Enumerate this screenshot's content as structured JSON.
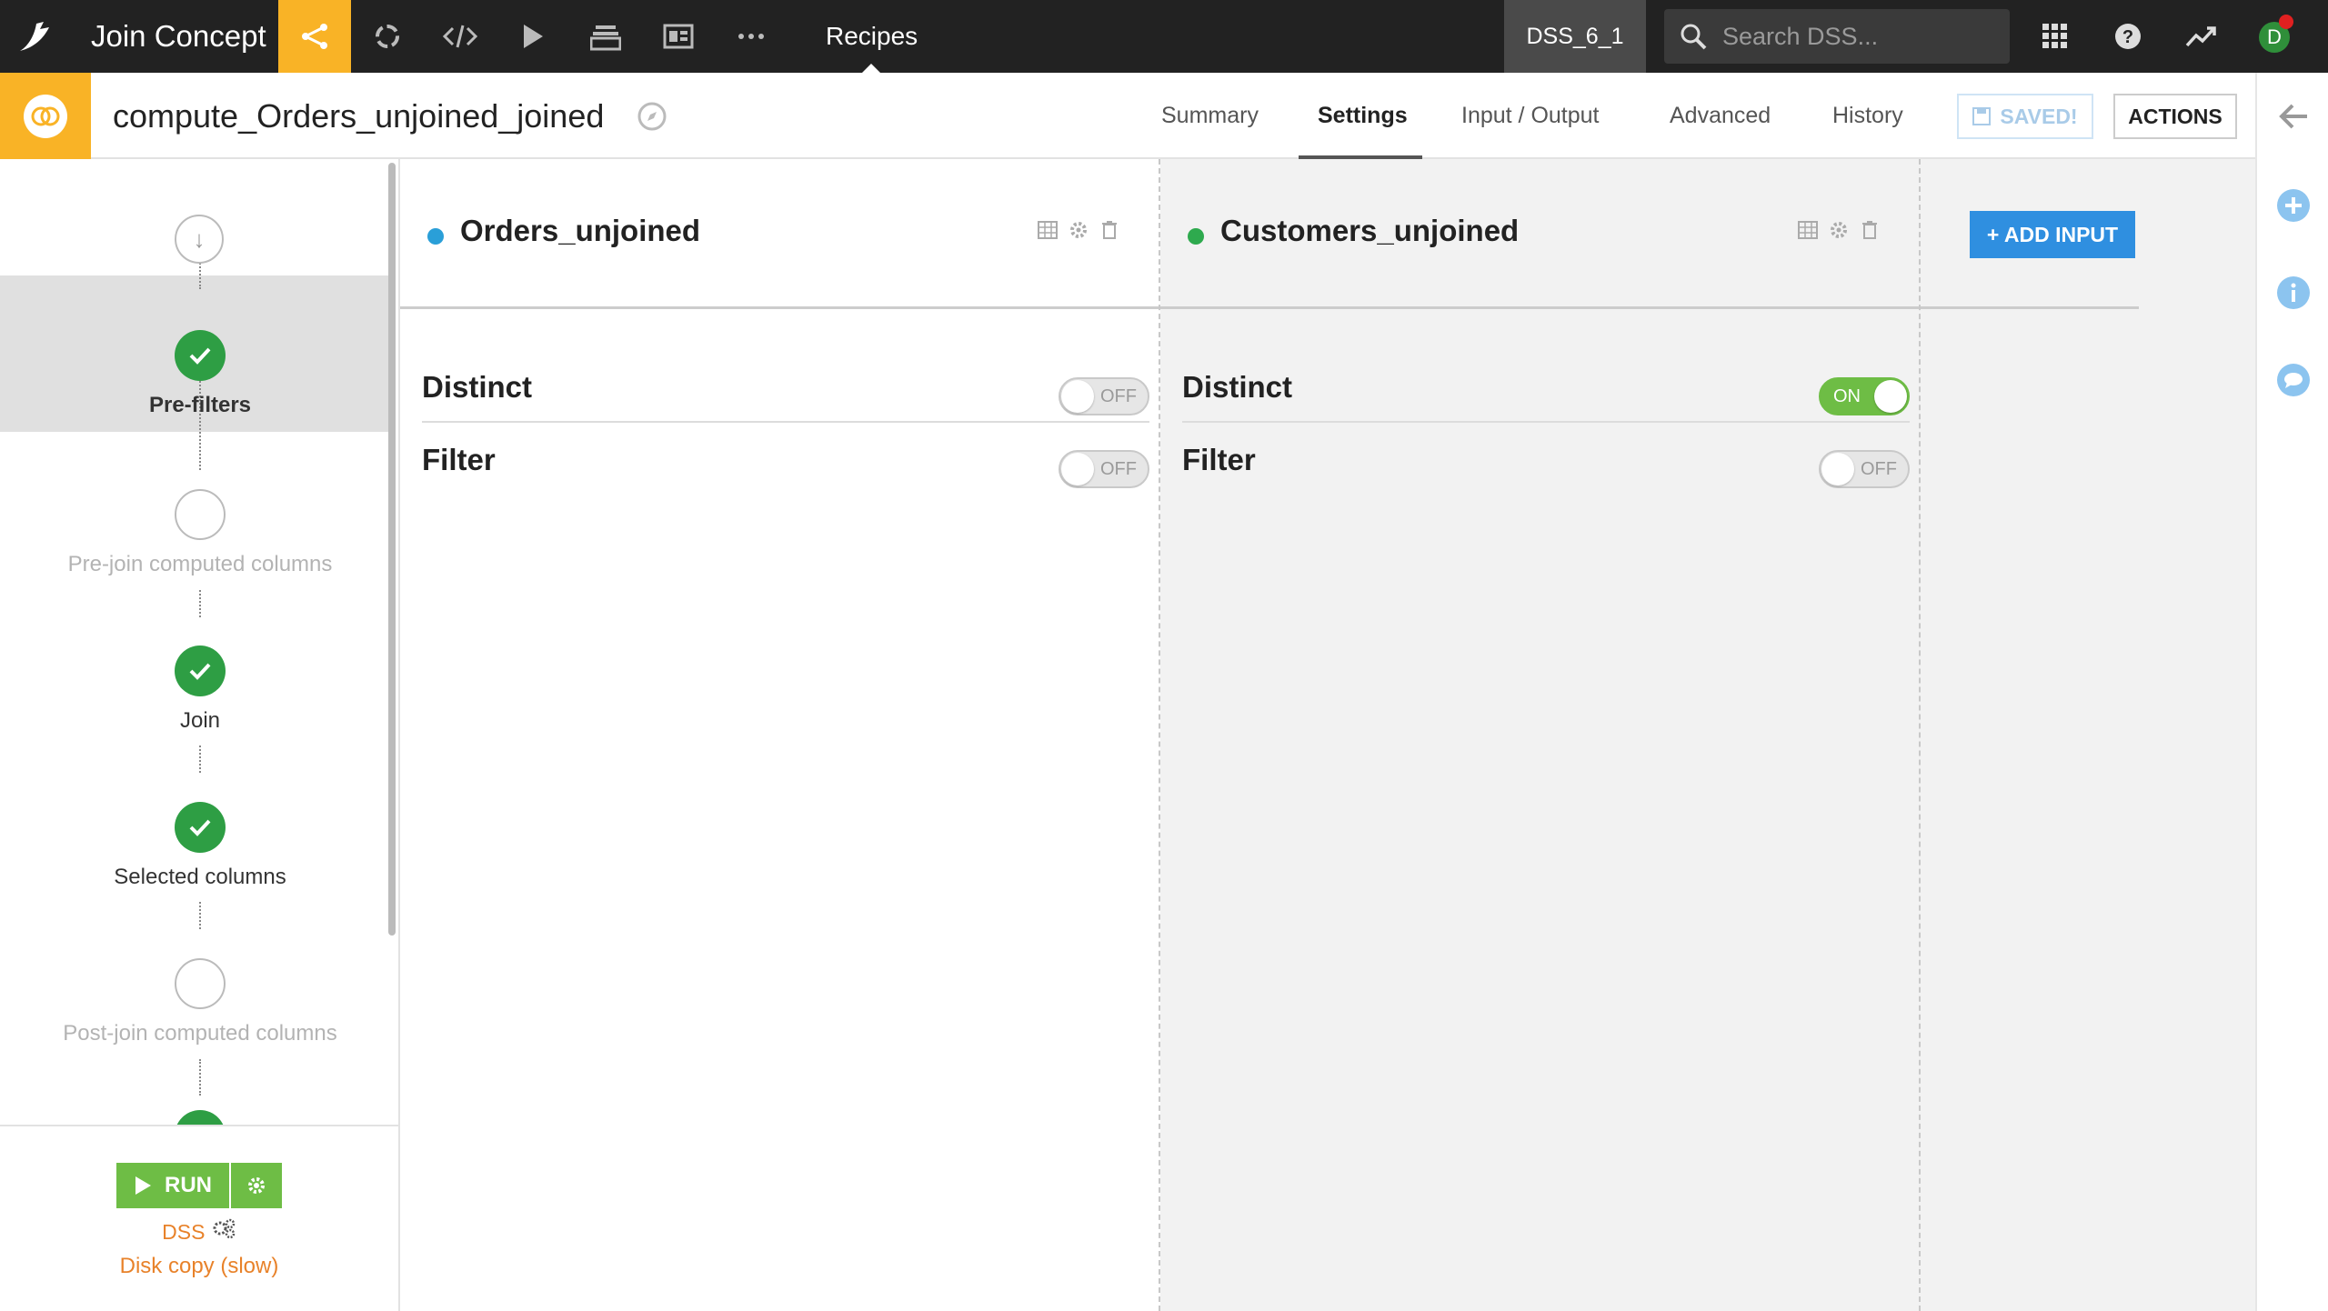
{
  "topbar": {
    "project_name": "Join Concept",
    "current_section": "Recipes",
    "instance_name": "DSS_6_1",
    "search_placeholder": "Search DSS...",
    "avatar_letter": "D",
    "icons": [
      "dataiku-logo-icon",
      "flow-icon",
      "lab-icon",
      "code-icon",
      "run-icon",
      "stack-icon",
      "dashboard-icon",
      "more-icon",
      "search-icon",
      "apps-grid-icon",
      "help-icon",
      "trend-icon"
    ],
    "colors": {
      "background": "#222222",
      "active_flow": "#f9b326",
      "notification": "#e02020"
    }
  },
  "recipe_header": {
    "title": "compute_Orders_unjoined_joined",
    "tabs": [
      {
        "label": "Summary",
        "active": false
      },
      {
        "label": "Settings",
        "active": true
      },
      {
        "label": "Input / Output",
        "active": false
      },
      {
        "label": "Advanced",
        "active": false
      },
      {
        "label": "History",
        "active": false
      }
    ],
    "saved_label": "SAVED!",
    "actions_label": "ACTIONS"
  },
  "steps": [
    {
      "label": "",
      "state": "start"
    },
    {
      "label": "Pre-filters",
      "state": "done",
      "active": true
    },
    {
      "label": "Pre-join computed columns",
      "state": "empty"
    },
    {
      "label": "Join",
      "state": "done"
    },
    {
      "label": "Selected columns",
      "state": "done"
    },
    {
      "label": "Post-join computed columns",
      "state": "empty"
    }
  ],
  "run_panel": {
    "run_label": "RUN",
    "engine_label": "DSS",
    "engine_detail": "Disk copy (slow)"
  },
  "inputs": [
    {
      "name": "Orders_unjoined",
      "dot_color": "#2a9fd8",
      "settings": [
        {
          "label": "Distinct",
          "state": "OFF"
        },
        {
          "label": "Filter",
          "state": "OFF"
        }
      ]
    },
    {
      "name": "Customers_unjoined",
      "dot_color": "#2eaa4e",
      "settings": [
        {
          "label": "Distinct",
          "state": "ON"
        },
        {
          "label": "Filter",
          "state": "OFF"
        }
      ]
    }
  ],
  "add_input_label": "+ ADD INPUT",
  "right_rail_icons": [
    "back-arrow-icon",
    "plus-circle-icon",
    "info-circle-icon",
    "chat-icon"
  ]
}
